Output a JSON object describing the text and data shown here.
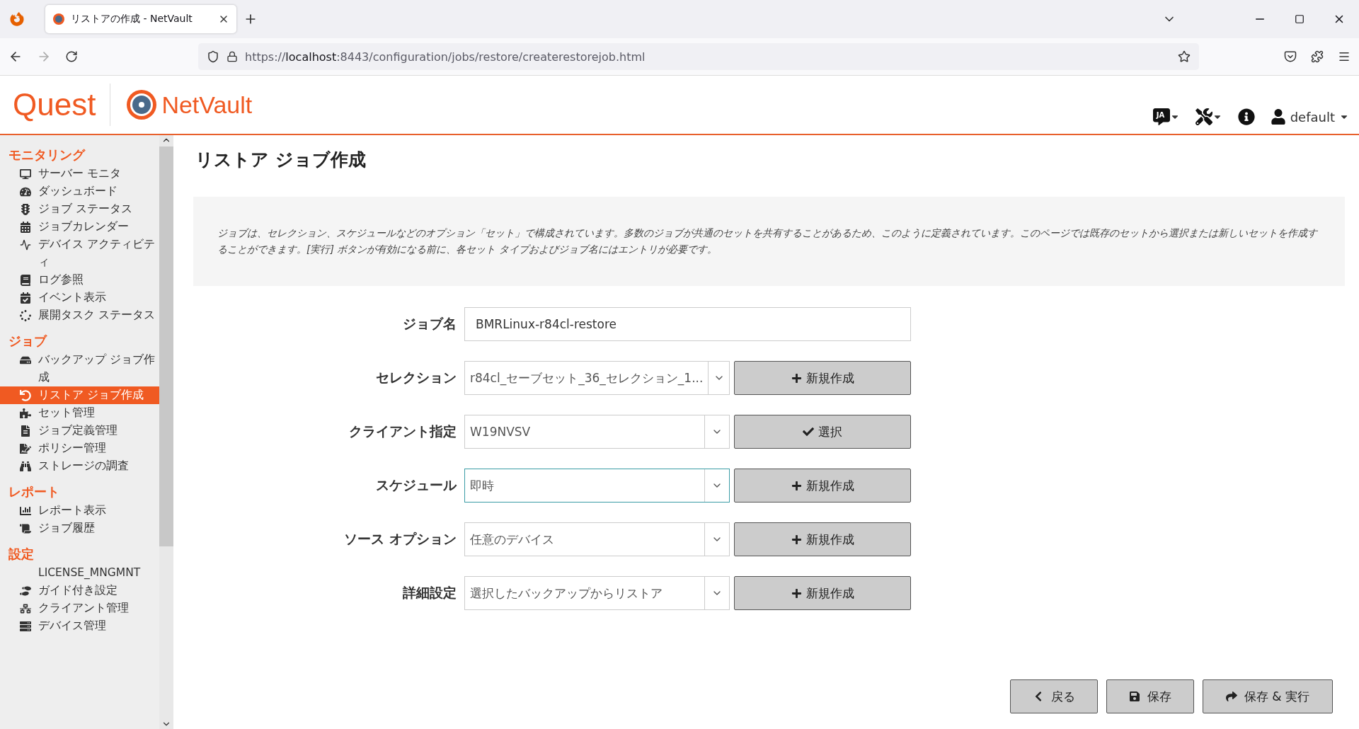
{
  "browser": {
    "tab_title": "リストアの作成 - NetVault",
    "url_scheme": "https://",
    "url_host": "localhost",
    "url_rest": ":8443/configuration/jobs/restore/createrestorejob.html"
  },
  "header": {
    "brand": "Quest",
    "product": "NetVault",
    "language": "JA",
    "user": "default"
  },
  "sidebar": {
    "sections": [
      {
        "title": "モニタリング",
        "items": [
          {
            "label": "サーバー モニタ",
            "selected": false
          },
          {
            "label": "ダッシュボード",
            "selected": false
          },
          {
            "label": "ジョブ ステータス",
            "selected": false
          },
          {
            "label": "ジョブカレンダー",
            "selected": false
          },
          {
            "label": "デバイス アクティビティ",
            "selected": false
          },
          {
            "label": "ログ参照",
            "selected": false
          },
          {
            "label": "イベント表示",
            "selected": false
          },
          {
            "label": "展開タスク ステータス",
            "selected": false
          }
        ]
      },
      {
        "title": "ジョブ",
        "items": [
          {
            "label": "バックアップ ジョブ作成",
            "selected": false
          },
          {
            "label": "リストア ジョブ作成",
            "selected": true
          },
          {
            "label": "セット管理",
            "selected": false
          },
          {
            "label": "ジョブ定義管理",
            "selected": false
          },
          {
            "label": "ポリシー管理",
            "selected": false
          },
          {
            "label": "ストレージの調査",
            "selected": false
          }
        ]
      },
      {
        "title": "レポート",
        "items": [
          {
            "label": "レポート表示",
            "selected": false
          },
          {
            "label": "ジョブ履歴",
            "selected": false
          }
        ]
      },
      {
        "title": "設定",
        "items": [
          {
            "label": "LICENSE_MNGMNT",
            "selected": false
          },
          {
            "label": "ガイド付き設定",
            "selected": false
          },
          {
            "label": "クライアント管理",
            "selected": false
          },
          {
            "label": "デバイス管理",
            "selected": false
          }
        ]
      }
    ]
  },
  "page": {
    "title": "リストア ジョブ作成",
    "description": "ジョブは、セレクション、スケジュールなどのオプション「セット」で構成されています。多数のジョブが共通のセットを共有することがあるため、このように定義されています。このページでは既存のセットから選択または新しいセットを作成することができます。[実行] ボタンが有効になる前に、各セット タイプおよびジョブ名にはエントリが必要です。"
  },
  "form": [
    {
      "kind": "text",
      "label": "ジョブ名",
      "value": "BMRLinux-r84cl-restore"
    },
    {
      "kind": "select",
      "label": "セレクション",
      "value": "r84cl_セーブセット_36_セレクション_1...",
      "focused": false,
      "button": {
        "kind": "new",
        "label": "新規作成"
      }
    },
    {
      "kind": "select",
      "label": "クライアント指定",
      "value": "W19NVSV",
      "focused": false,
      "button": {
        "kind": "choose",
        "label": "選択"
      }
    },
    {
      "kind": "select",
      "label": "スケジュール",
      "value": "即時",
      "focused": true,
      "button": {
        "kind": "new",
        "label": "新規作成"
      }
    },
    {
      "kind": "select",
      "label": "ソース オプション",
      "value": "任意のデバイス",
      "focused": false,
      "button": {
        "kind": "new",
        "label": "新規作成"
      }
    },
    {
      "kind": "select",
      "label": "詳細設定",
      "value": "選択したバックアップからリストア",
      "focused": false,
      "button": {
        "kind": "new",
        "label": "新規作成"
      }
    }
  ],
  "footer": {
    "buttons": [
      "戻る",
      "保存",
      "保存 & 実行"
    ]
  }
}
